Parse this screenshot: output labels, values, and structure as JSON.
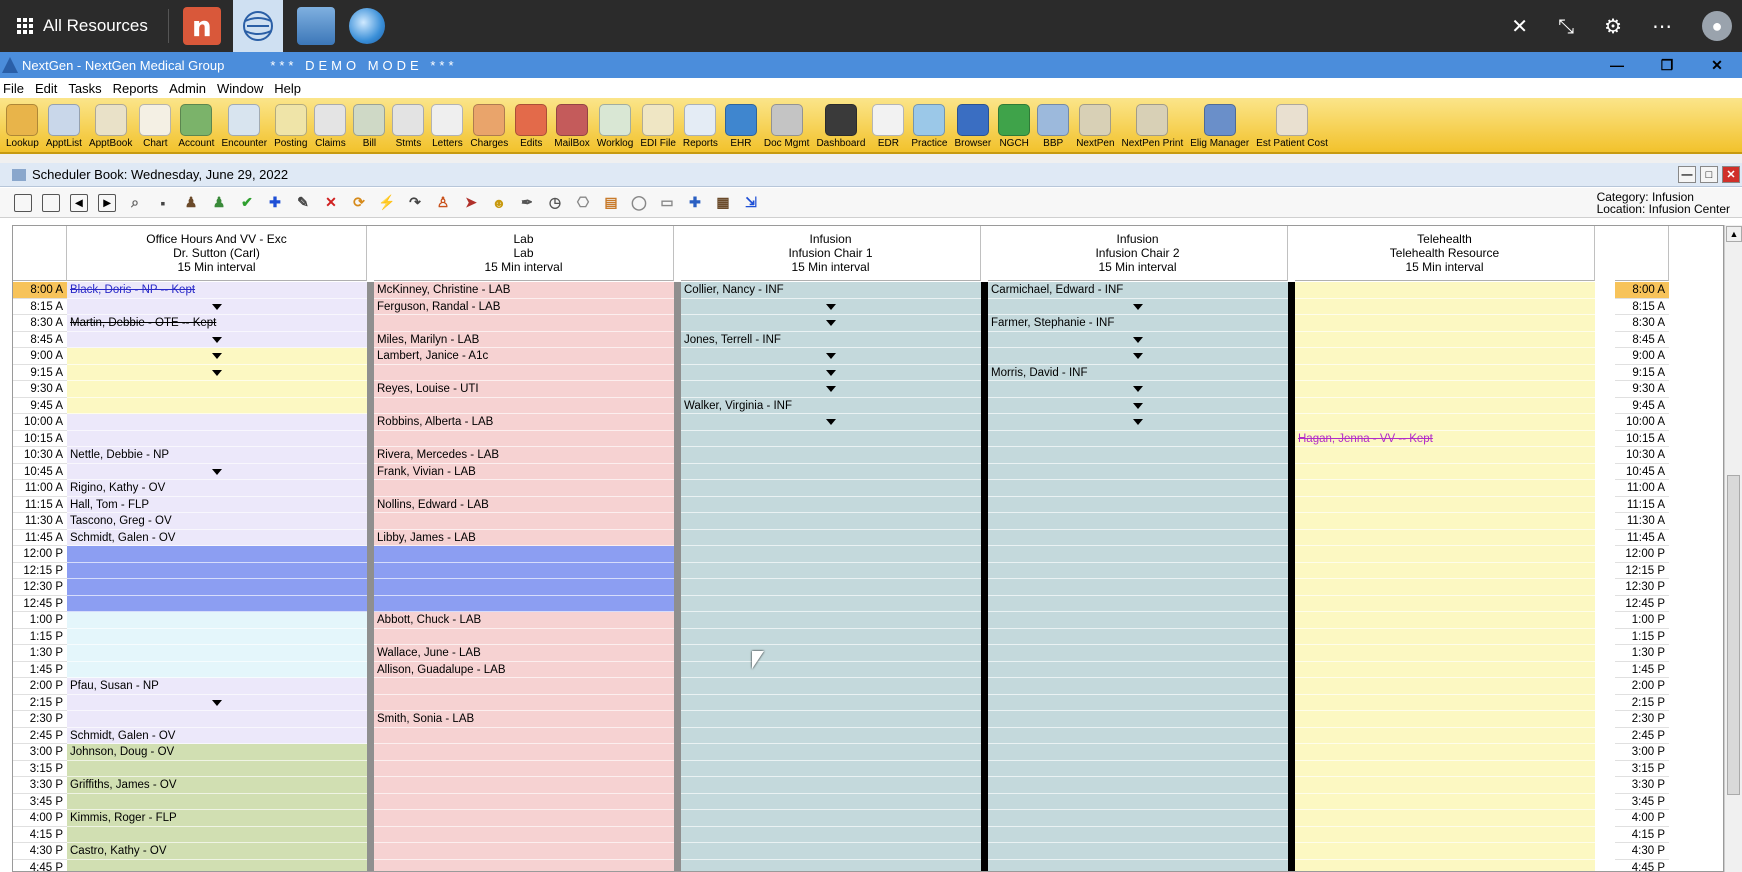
{
  "taskbar": {
    "all_resources": "All Resources",
    "app_n_letter": "n"
  },
  "window": {
    "title": "NextGen - NextGen Medical Group",
    "demo": "*** DEMO MODE ***"
  },
  "menu": [
    "File",
    "Edit",
    "Tasks",
    "Reports",
    "Admin",
    "Window",
    "Help"
  ],
  "toolbar": [
    {
      "label": "Lookup",
      "color": "#e8b44a"
    },
    {
      "label": "ApptList",
      "color": "#c9d7ea"
    },
    {
      "label": "ApptBook",
      "color": "#e9e1c8"
    },
    {
      "label": "Chart",
      "color": "#f4f0e4"
    },
    {
      "label": "Account",
      "color": "#7bb36a"
    },
    {
      "label": "Encounter",
      "color": "#d8e4ef"
    },
    {
      "label": "Posting",
      "color": "#efe4a8"
    },
    {
      "label": "Claims",
      "color": "#e4e4e4"
    },
    {
      "label": "Bill",
      "color": "#cfd9c6"
    },
    {
      "label": "Stmts",
      "color": "#e3e3e3"
    },
    {
      "label": "Letters",
      "color": "#efefef"
    },
    {
      "label": "Charges",
      "color": "#e9a46b"
    },
    {
      "label": "Edits",
      "color": "#e36a4a"
    },
    {
      "label": "MailBox",
      "color": "#c45b5b"
    },
    {
      "label": "Worklog",
      "color": "#d9e7d4"
    },
    {
      "label": "EDI File",
      "color": "#efe6c4"
    },
    {
      "label": "Reports",
      "color": "#e4ecf5"
    },
    {
      "label": "EHR",
      "color": "#3f86cf"
    },
    {
      "label": "Doc Mgmt",
      "color": "#c4c4c4"
    },
    {
      "label": "Dashboard",
      "color": "#3a3a3a"
    },
    {
      "label": "EDR",
      "color": "#f2f2f2"
    },
    {
      "label": "Practice",
      "color": "#9bc8e8"
    },
    {
      "label": "Browser",
      "color": "#3a6ec2"
    },
    {
      "label": "NGCH",
      "color": "#3fa34a"
    },
    {
      "label": "BBP",
      "color": "#9cb9dc"
    },
    {
      "label": "NextPen",
      "color": "#d8d0b6"
    },
    {
      "label": "NextPen Print",
      "color": "#d8d0b6"
    },
    {
      "label": "Elig Manager",
      "color": "#6a8fc9"
    },
    {
      "label": "Est Patient Cost",
      "color": "#e9e0d0"
    }
  ],
  "scheduler": {
    "title": "Scheduler Book: Wednesday, June 29, 2022",
    "category": "Category: Infusion",
    "location": "Location: Infusion Center",
    "times": [
      "8:00 A",
      "8:15 A",
      "8:30 A",
      "8:45 A",
      "9:00 A",
      "9:15 A",
      "9:30 A",
      "9:45 A",
      "10:00 A",
      "10:15 A",
      "10:30 A",
      "10:45 A",
      "11:00 A",
      "11:15 A",
      "11:30 A",
      "11:45 A",
      "12:00 P",
      "12:15 P",
      "12:30 P",
      "12:45 P",
      "1:00 P",
      "1:15 P",
      "1:30 P",
      "1:45 P",
      "2:00 P",
      "2:15 P",
      "2:30 P",
      "2:45 P",
      "3:00 P",
      "3:15 P",
      "3:30 P",
      "3:45 P",
      "4:00 P",
      "4:15 P",
      "4:30 P",
      "4:45 P"
    ],
    "columns": [
      {
        "line1": "Office Hours And VV - Exc",
        "line2": "Dr. Sutton (Carl)",
        "line3": "15 Min interval",
        "cells": [
          {
            "text": "Black, Doris - NP -- Kept",
            "bg": "#ece8fa",
            "style": "kept-blue"
          },
          {
            "text": "",
            "bg": "#ece8fa",
            "arrow": true
          },
          {
            "text": "Martin, Debbie - OTE -- Kept",
            "bg": "#ece8fa",
            "style": "kept"
          },
          {
            "text": "",
            "bg": "#ece8fa",
            "arrow": true
          },
          {
            "text": "",
            "bg": "#fcf8c2",
            "arrow": true
          },
          {
            "text": "",
            "bg": "#fcf8c2",
            "arrow": true
          },
          {
            "text": "",
            "bg": "#fcf8c2"
          },
          {
            "text": "",
            "bg": "#fcf8c2"
          },
          {
            "text": "",
            "bg": "#ece8fa"
          },
          {
            "text": "",
            "bg": "#ece8fa"
          },
          {
            "text": "Nettle, Debbie - NP",
            "bg": "#ece8fa"
          },
          {
            "text": "",
            "bg": "#ece8fa",
            "arrow": true
          },
          {
            "text": "Rigino, Kathy - OV",
            "bg": "#ece8fa"
          },
          {
            "text": "Hall, Tom - FLP",
            "bg": "#ece8fa"
          },
          {
            "text": "Tascono, Greg - OV",
            "bg": "#ece8fa"
          },
          {
            "text": "Schmidt, Galen - OV",
            "bg": "#ece8fa"
          },
          {
            "text": "",
            "bg": "#8c9ef2"
          },
          {
            "text": "",
            "bg": "#8c9ef2"
          },
          {
            "text": "",
            "bg": "#8c9ef2"
          },
          {
            "text": "",
            "bg": "#8c9ef2"
          },
          {
            "text": "",
            "bg": "#e4f6fb"
          },
          {
            "text": "",
            "bg": "#e4f6fb"
          },
          {
            "text": "",
            "bg": "#e4f6fb"
          },
          {
            "text": "",
            "bg": "#e4f6fb"
          },
          {
            "text": "Pfau, Susan - NP",
            "bg": "#ece8fa"
          },
          {
            "text": "",
            "bg": "#ece8fa",
            "arrow": true
          },
          {
            "text": "",
            "bg": "#ece8fa"
          },
          {
            "text": "Schmidt, Galen - OV",
            "bg": "#ece8fa"
          },
          {
            "text": "Johnson, Doug - OV",
            "bg": "#d1dfb2"
          },
          {
            "text": "",
            "bg": "#d1dfb2"
          },
          {
            "text": "Griffiths, James - OV",
            "bg": "#d1dfb2"
          },
          {
            "text": "",
            "bg": "#d1dfb2"
          },
          {
            "text": "Kimmis, Roger - FLP",
            "bg": "#d1dfb2"
          },
          {
            "text": "",
            "bg": "#d1dfb2"
          },
          {
            "text": "Castro, Kathy - OV",
            "bg": "#d1dfb2"
          },
          {
            "text": "",
            "bg": "#d1dfb2"
          }
        ]
      },
      {
        "line1": "Lab",
        "line2": "Lab",
        "line3": "15 Min interval",
        "default_bg": "#f6d2d2",
        "cells": [
          {
            "text": "McKinney, Christine - LAB"
          },
          {
            "text": "Ferguson, Randal - LAB"
          },
          {
            "text": ""
          },
          {
            "text": "Miles, Marilyn - LAB"
          },
          {
            "text": "Lambert, Janice - A1c"
          },
          {
            "text": ""
          },
          {
            "text": "Reyes, Louise - UTI"
          },
          {
            "text": ""
          },
          {
            "text": "Robbins, Alberta - LAB"
          },
          {
            "text": ""
          },
          {
            "text": "Rivera, Mercedes - LAB"
          },
          {
            "text": "Frank, Vivian - LAB"
          },
          {
            "text": ""
          },
          {
            "text": "Nollins, Edward - LAB"
          },
          {
            "text": ""
          },
          {
            "text": "Libby, James - LAB"
          },
          {
            "text": "",
            "bg": "#8c9ef2"
          },
          {
            "text": "",
            "bg": "#8c9ef2"
          },
          {
            "text": "",
            "bg": "#8c9ef2"
          },
          {
            "text": "",
            "bg": "#8c9ef2"
          },
          {
            "text": "Abbott, Chuck - LAB"
          },
          {
            "text": ""
          },
          {
            "text": "Wallace, June - LAB"
          },
          {
            "text": "Allison, Guadalupe - LAB"
          },
          {
            "text": ""
          },
          {
            "text": ""
          },
          {
            "text": "Smith, Sonia - LAB"
          },
          {
            "text": ""
          },
          {
            "text": ""
          },
          {
            "text": ""
          },
          {
            "text": ""
          },
          {
            "text": ""
          },
          {
            "text": ""
          },
          {
            "text": ""
          },
          {
            "text": ""
          },
          {
            "text": ""
          }
        ]
      },
      {
        "line1": "Infusion",
        "line2": "Infusion Chair 1",
        "line3": "15 Min interval",
        "default_bg": "#c4d9dc",
        "cells": [
          {
            "text": "Collier, Nancy - INF"
          },
          {
            "text": "",
            "arrow": true
          },
          {
            "text": "",
            "arrow": true
          },
          {
            "text": "Jones, Terrell - INF"
          },
          {
            "text": "",
            "arrow": true
          },
          {
            "text": "",
            "arrow": true
          },
          {
            "text": "",
            "arrow": true
          },
          {
            "text": "Walker, Virginia - INF"
          },
          {
            "text": "",
            "arrow": true
          },
          {
            "text": ""
          },
          {
            "text": ""
          },
          {
            "text": ""
          },
          {
            "text": ""
          },
          {
            "text": ""
          },
          {
            "text": ""
          },
          {
            "text": ""
          },
          {
            "text": ""
          },
          {
            "text": ""
          },
          {
            "text": ""
          },
          {
            "text": ""
          },
          {
            "text": ""
          },
          {
            "text": ""
          },
          {
            "text": ""
          },
          {
            "text": ""
          },
          {
            "text": ""
          },
          {
            "text": ""
          },
          {
            "text": ""
          },
          {
            "text": ""
          },
          {
            "text": ""
          },
          {
            "text": ""
          },
          {
            "text": ""
          },
          {
            "text": ""
          },
          {
            "text": ""
          },
          {
            "text": ""
          },
          {
            "text": ""
          },
          {
            "text": ""
          }
        ]
      },
      {
        "line1": "Infusion",
        "line2": "Infusion Chair 2",
        "line3": "15 Min interval",
        "default_bg": "#c4d9dc",
        "cells": [
          {
            "text": "Carmichael, Edward - INF"
          },
          {
            "text": "",
            "arrow": true
          },
          {
            "text": "Farmer, Stephanie - INF"
          },
          {
            "text": "",
            "arrow": true
          },
          {
            "text": "",
            "arrow": true
          },
          {
            "text": "Morris, David - INF"
          },
          {
            "text": "",
            "arrow": true
          },
          {
            "text": "",
            "arrow": true
          },
          {
            "text": "",
            "arrow": true
          },
          {
            "text": ""
          },
          {
            "text": ""
          },
          {
            "text": ""
          },
          {
            "text": ""
          },
          {
            "text": ""
          },
          {
            "text": ""
          },
          {
            "text": ""
          },
          {
            "text": ""
          },
          {
            "text": ""
          },
          {
            "text": ""
          },
          {
            "text": ""
          },
          {
            "text": ""
          },
          {
            "text": ""
          },
          {
            "text": ""
          },
          {
            "text": ""
          },
          {
            "text": ""
          },
          {
            "text": ""
          },
          {
            "text": ""
          },
          {
            "text": ""
          },
          {
            "text": ""
          },
          {
            "text": ""
          },
          {
            "text": ""
          },
          {
            "text": ""
          },
          {
            "text": ""
          },
          {
            "text": ""
          },
          {
            "text": ""
          },
          {
            "text": ""
          }
        ]
      },
      {
        "line1": "Telehealth",
        "line2": "Telehealth Resource",
        "line3": "15 Min interval",
        "default_bg": "#fcf8c2",
        "cells": [
          {
            "text": ""
          },
          {
            "text": ""
          },
          {
            "text": ""
          },
          {
            "text": ""
          },
          {
            "text": ""
          },
          {
            "text": ""
          },
          {
            "text": ""
          },
          {
            "text": ""
          },
          {
            "text": ""
          },
          {
            "text": "Hagan, Jenna - VV -- Kept",
            "style": "kept-purple"
          },
          {
            "text": ""
          },
          {
            "text": ""
          },
          {
            "text": ""
          },
          {
            "text": ""
          },
          {
            "text": ""
          },
          {
            "text": ""
          },
          {
            "text": ""
          },
          {
            "text": ""
          },
          {
            "text": ""
          },
          {
            "text": ""
          },
          {
            "text": ""
          },
          {
            "text": ""
          },
          {
            "text": ""
          },
          {
            "text": ""
          },
          {
            "text": ""
          },
          {
            "text": ""
          },
          {
            "text": ""
          },
          {
            "text": ""
          },
          {
            "text": ""
          },
          {
            "text": ""
          },
          {
            "text": ""
          },
          {
            "text": ""
          },
          {
            "text": ""
          },
          {
            "text": ""
          },
          {
            "text": ""
          },
          {
            "text": ""
          }
        ]
      }
    ]
  }
}
